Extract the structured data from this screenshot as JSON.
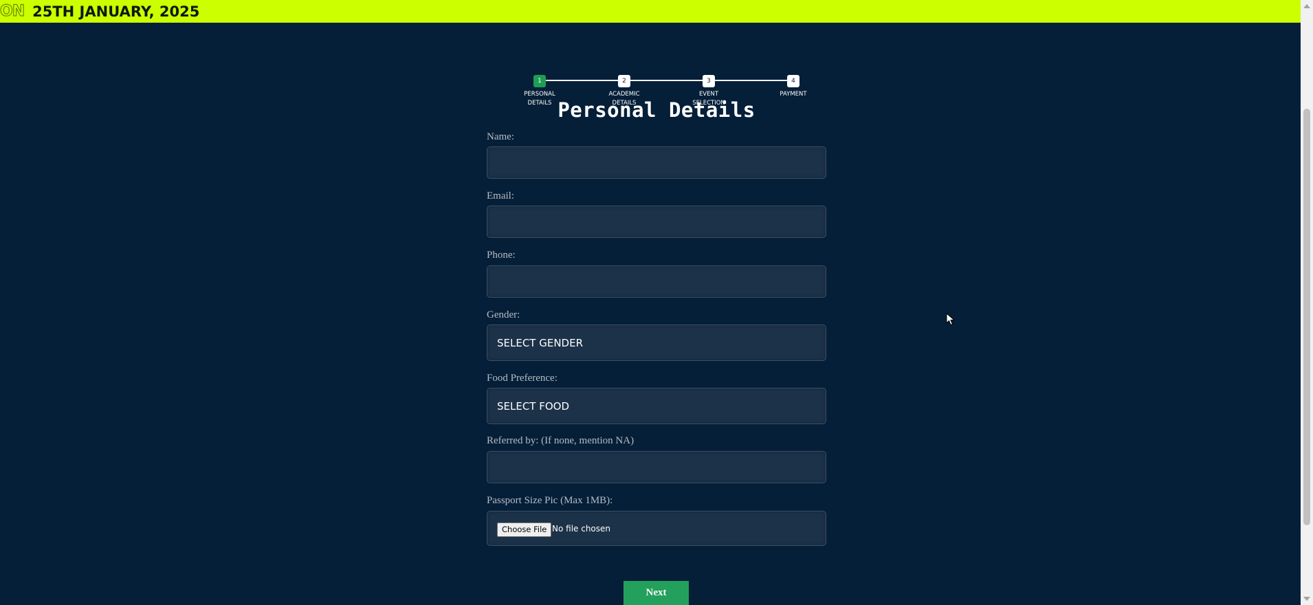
{
  "banner": {
    "ticker_fragment": "ON",
    "date_text": "25TH JANUARY, 2025"
  },
  "stepper": {
    "current_step": 1,
    "steps": [
      {
        "number": "1",
        "label": "PERSONAL\nDETAILS"
      },
      {
        "number": "2",
        "label": "ACADEMIC\nDETAILS"
      },
      {
        "number": "3",
        "label": "EVENT\nSELECTION"
      },
      {
        "number": "4",
        "label": "PAYMENT"
      }
    ]
  },
  "form": {
    "title": "Personal Details",
    "name": {
      "label": "Name:",
      "value": ""
    },
    "email": {
      "label": "Email:",
      "value": ""
    },
    "phone": {
      "label": "Phone:",
      "value": ""
    },
    "gender": {
      "label": "Gender:",
      "selected": "SELECT GENDER"
    },
    "food": {
      "label": "Food Preference:",
      "selected": "SELECT FOOD"
    },
    "referred": {
      "label": "Referred by: (If none, mention NA)",
      "value": ""
    },
    "photo": {
      "label": "Passport Size Pic (Max 1MB):",
      "button": "Choose File",
      "status": "No file chosen"
    },
    "next_label": "Next"
  },
  "colors": {
    "banner_bg": "#ccff00",
    "page_bg": "#051f38",
    "field_bg": "#1c3249",
    "accent_green": "#23a05b"
  }
}
